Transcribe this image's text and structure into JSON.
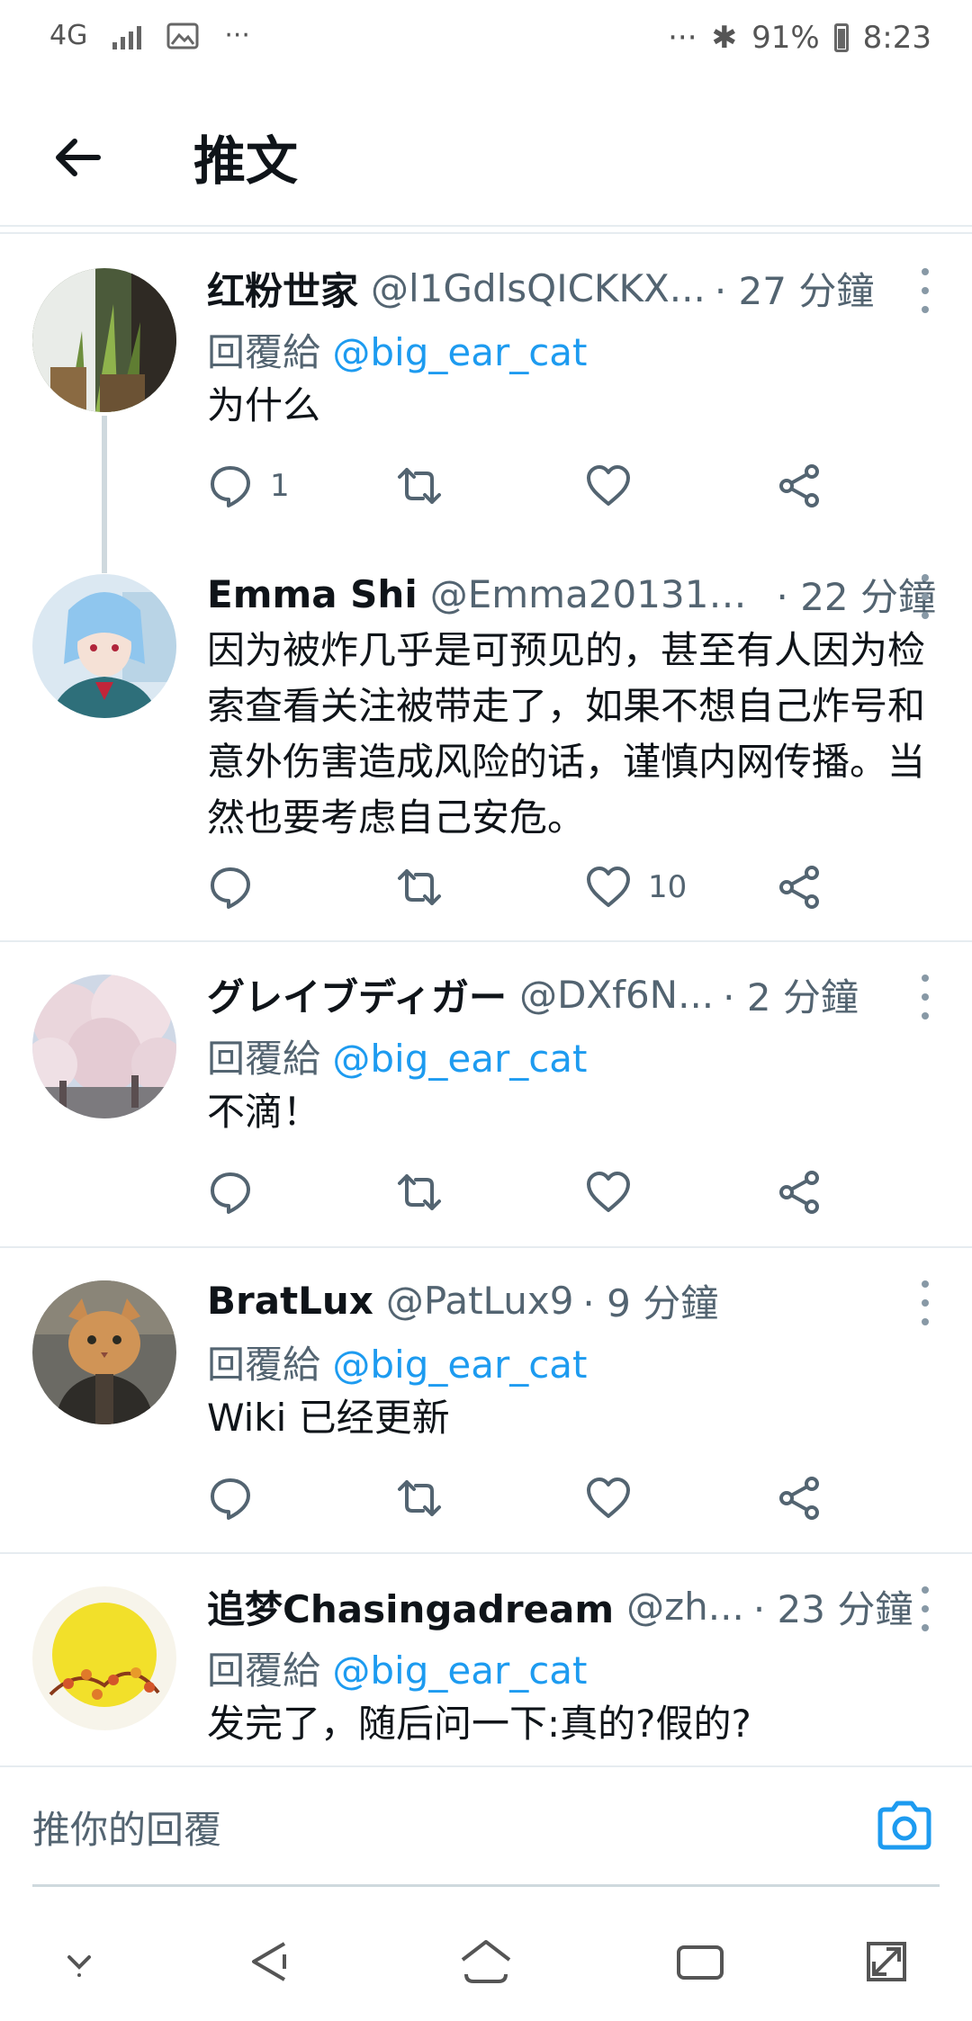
{
  "status_bar": {
    "network": "4G",
    "more_left": "···",
    "more_right": "···",
    "bluetooth": "✱",
    "battery": "91%",
    "time": "8:23"
  },
  "header": {
    "title": "推文"
  },
  "tweets": [
    {
      "name": "红粉世家",
      "handle": "@l1GdlsQICKKX...",
      "time": "· 27 分鐘",
      "reply_prefix": "回覆給",
      "reply_to": "@big_ear_cat",
      "text": "为什么",
      "reply_count": "1",
      "like_count": ""
    },
    {
      "name": "Emma Shi",
      "handle": "@Emma201316...",
      "time": "· 22 分鐘",
      "text": "因为被炸几乎是可预见的，甚至有人因为检索查看关注被带走了，如果不想自己炸号和意外伤害造成风险的话，谨慎内网传播。当然也要考虑自己安危。",
      "reply_count": "",
      "like_count": "10"
    },
    {
      "name": "グレイブディガー",
      "handle": "@DXf6N...",
      "time": "· 2 分鐘",
      "reply_prefix": "回覆給",
      "reply_to": "@big_ear_cat",
      "text": "不滴！",
      "reply_count": "",
      "like_count": ""
    },
    {
      "name": "BratLux",
      "handle": "@PatLux9",
      "time": "· 9 分鐘",
      "reply_prefix": "回覆給",
      "reply_to": "@big_ear_cat",
      "text": "Wiki 已经更新",
      "reply_count": "",
      "like_count": ""
    },
    {
      "name": "追梦Chasingadream",
      "handle": "@zh...",
      "time": "· 23 分鐘",
      "reply_prefix": "回覆給",
      "reply_to": "@big_ear_cat",
      "text": "发完了，随后问一下:真的?假的?"
    }
  ],
  "compose": {
    "placeholder": "推你的回覆"
  },
  "colors": {
    "accent": "#1d9bf0",
    "secondary_text": "#536471",
    "divider": "#e6ecf0"
  },
  "icons": {
    "reply": "comment-icon",
    "retweet": "retweet-icon",
    "like": "heart-icon",
    "share": "share-icon",
    "camera": "camera-icon"
  }
}
